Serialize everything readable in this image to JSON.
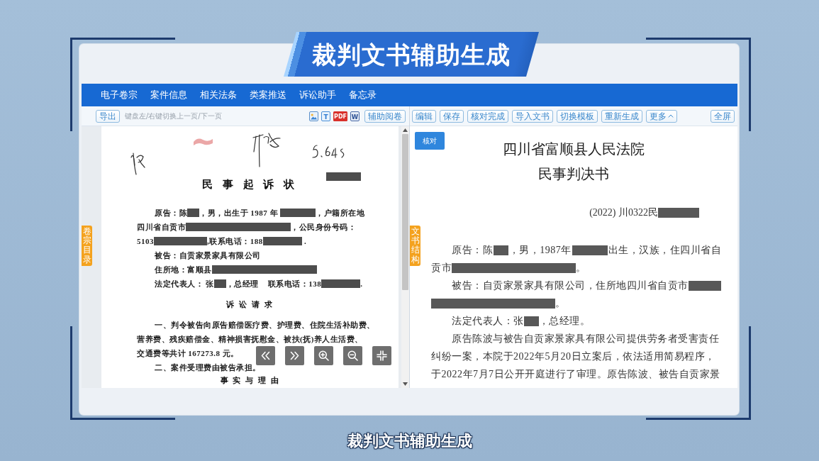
{
  "banner": {
    "title": "裁判文书辅助生成"
  },
  "tabs": [
    {
      "label": "电子卷宗",
      "selected": false
    },
    {
      "label": "案件信息",
      "selected": false
    },
    {
      "label": "相关法条",
      "selected": false
    },
    {
      "label": "类案推送",
      "selected": false
    },
    {
      "label": "诉讼助手",
      "selected": false
    },
    {
      "label": "备忘录",
      "selected": false
    }
  ],
  "left_toolbar": {
    "export_button": "导出",
    "hint": "键盘左/右键切换上一页/下一页",
    "file_icons": [
      {
        "kind": "image"
      },
      {
        "kind": "txt",
        "letter": "T"
      },
      {
        "kind": "pdf",
        "letter": "PDF"
      },
      {
        "kind": "word",
        "letter": "W"
      }
    ],
    "assist_button": "辅助阅卷"
  },
  "right_toolbar": {
    "buttons": [
      {
        "label": "编辑",
        "kind": "action"
      },
      {
        "label": "保存",
        "kind": "action"
      },
      {
        "label": "核对完成",
        "kind": "action"
      },
      {
        "label": "导入文书",
        "kind": "action"
      },
      {
        "label": "切换模板",
        "kind": "action"
      },
      {
        "label": "重新生成",
        "kind": "action"
      },
      {
        "label": "更多",
        "kind": "menu"
      }
    ],
    "fullscreen_button": "全屏"
  },
  "left_pane": {
    "side_tab": "卷宗目录",
    "scan": {
      "blocks": [
        {
          "kind": "title",
          "text": "民 事 起 诉 状",
          "redacted": true
        },
        {
          "kind": "paragraph",
          "lines": [
            [
              {
                "kind": "text",
                "text": "原告：陈"
              },
              {
                "kind": "redacted_name"
              },
              {
                "kind": "text",
                "text": "，男，出生于 1987 年 "
              },
              {
                "kind": "redacted_date"
              },
              {
                "kind": "text",
                "text": "，户籍所在地"
              }
            ],
            [
              {
                "kind": "text",
                "text": "四川省自贡市"
              },
              {
                "kind": "redacted_address"
              },
              {
                "kind": "text",
                "text": "，公民身份号码："
              }
            ],
            [
              {
                "kind": "text",
                "text": "5103"
              },
              {
                "kind": "redacted_id_number"
              },
              {
                "kind": "text",
                "text": ",联系电话：188"
              },
              {
                "kind": "redacted_phone"
              },
              {
                "kind": "text",
                "text": " ."
              }
            ]
          ]
        },
        {
          "kind": "paragraph",
          "lines": [
            [
              {
                "kind": "text",
                "text": "被告：自贡家景家具有限公司"
              }
            ]
          ]
        },
        {
          "kind": "paragraph",
          "lines": [
            [
              {
                "kind": "text",
                "text": "住所地：富顺县"
              },
              {
                "kind": "redacted_address"
              }
            ]
          ]
        },
        {
          "kind": "paragraph",
          "lines": [
            [
              {
                "kind": "text",
                "text": "法定代表人： 张"
              },
              {
                "kind": "redacted_name"
              },
              {
                "kind": "text",
                "text": "，总经理    联系电话：138"
              },
              {
                "kind": "redacted_phone"
              },
              {
                "kind": "text",
                "text": "."
              }
            ]
          ]
        },
        {
          "kind": "heading",
          "text": "诉 讼 请 求"
        },
        {
          "kind": "paragraph",
          "lines": [
            [
              {
                "kind": "text",
                "text": "一、判令被告向原告赔偿医疗费、护理费、住院生活补助费、"
              }
            ],
            [
              {
                "kind": "text",
                "text": "营养费、残疾赔偿金、精神损害抚慰金、被扶(抚)养人生活费、"
              }
            ],
            [
              {
                "kind": "text",
                "text": "交通费等共计 167273.8 元。"
              }
            ]
          ]
        },
        {
          "kind": "paragraph",
          "lines": [
            [
              {
                "kind": "text",
                "text": "二、案件受理费由被告承担。"
              }
            ]
          ]
        },
        {
          "kind": "heading",
          "text": "事 实 与 理 由"
        }
      ]
    },
    "page_controls": [
      {
        "kind": "previous"
      },
      {
        "kind": "next"
      },
      {
        "kind": "zoom_in"
      },
      {
        "kind": "zoom_out"
      },
      {
        "kind": "fit"
      }
    ]
  },
  "right_pane": {
    "side_tab": "文书结构",
    "check_button": "核对",
    "court": "四川省富顺县人民法院",
    "document_type": "民事判决书",
    "case_number": [
      {
        "kind": "text",
        "text": "(2022) 川0322民"
      },
      {
        "kind": "redacted_case_number"
      }
    ],
    "paragraphs": [
      {
        "lines": [
          [
            {
              "kind": "text",
              "text": "原告：陈"
            },
            {
              "kind": "redacted_name"
            },
            {
              "kind": "text",
              "text": "，男，1987年"
            },
            {
              "kind": "redacted_date"
            },
            {
              "kind": "text",
              "text": "出生，汉族，住四川省自"
            }
          ],
          [
            {
              "kind": "text",
              "text": "贡市"
            },
            {
              "kind": "redacted_address"
            },
            {
              "kind": "text",
              "text": "。"
            }
          ]
        ]
      },
      {
        "lines": [
          [
            {
              "kind": "text",
              "text": "被告：自贡家景家具有限公司，住所地四川省自贡市"
            },
            {
              "kind": "redacted_address"
            }
          ],
          [
            {
              "kind": "redacted_address"
            },
            {
              "kind": "text",
              "text": "。"
            }
          ]
        ]
      },
      {
        "lines": [
          [
            {
              "kind": "text",
              "text": "法定代表人：张"
            },
            {
              "kind": "redacted_name"
            },
            {
              "kind": "text",
              "text": "，总经理。"
            }
          ]
        ]
      },
      {
        "lines": [
          [
            {
              "kind": "text",
              "text": "原告陈波与被告自贡家景家具有限公司提供劳务者受害责任"
            }
          ],
          [
            {
              "kind": "text",
              "text": "纠纷一案，本院于2022年5月20日立案后，依法适用简易程序，"
            }
          ],
          [
            {
              "kind": "text",
              "text": "于2022年7月7日公开开庭进行了审理。原告陈波、被告自贡家景"
            }
          ]
        ]
      }
    ]
  },
  "caption": "裁判文书辅助生成"
}
